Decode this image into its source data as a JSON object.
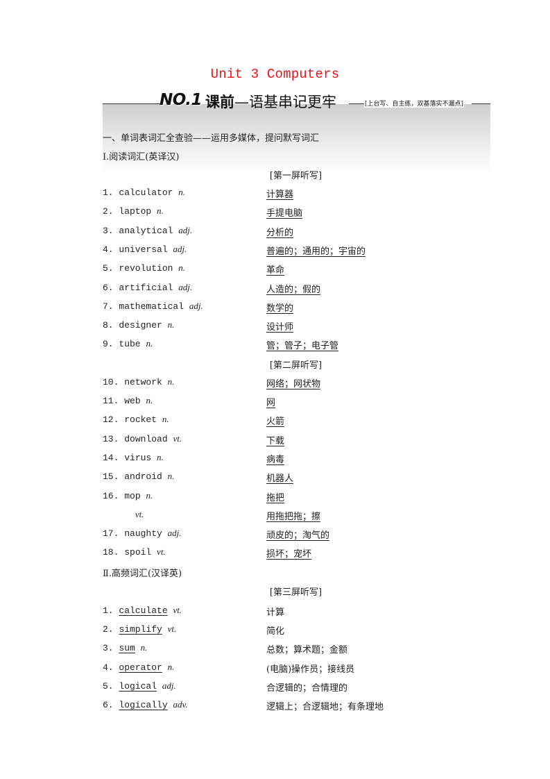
{
  "title": "Unit 3  Computers",
  "banner": {
    "number": "NO.1",
    "heading_bold": "课前",
    "heading_rest": "—语基串记更牢",
    "note": "[上台写、自主练，双基落实不漏点]"
  },
  "section_heading": "一、单词表词汇全查验——运用多媒体，提问默写词汇",
  "part1": {
    "heading": "Ⅰ.阅读词汇(英译汉)",
    "screens": [
      {
        "label": "[第一屏听写]",
        "items": [
          {
            "n": "1.",
            "word": "calculator",
            "pos": "n.",
            "meaning": "计算器"
          },
          {
            "n": "2.",
            "word": "laptop",
            "pos": "n.",
            "meaning": "手提电脑"
          },
          {
            "n": "3.",
            "word": "analytical",
            "pos": "adj.",
            "meaning": "分析的"
          },
          {
            "n": "4.",
            "word": "universal",
            "pos": "adj.",
            "meaning": "普遍的；通用的；宇宙的"
          },
          {
            "n": "5.",
            "word": "revolution",
            "pos": "n.",
            "meaning": "革命"
          },
          {
            "n": "6.",
            "word": "artificial",
            "pos": "adj.",
            "meaning": "人造的；假的"
          },
          {
            "n": "7.",
            "word": "mathematical",
            "pos": "adj.",
            "meaning": "数学的"
          },
          {
            "n": "8.",
            "word": "designer",
            "pos": "n.",
            "meaning": "设计师"
          },
          {
            "n": "9.",
            "word": "tube",
            "pos": "n.",
            "meaning": "管；管子；电子管"
          }
        ]
      },
      {
        "label": "[第二屏听写]",
        "items": [
          {
            "n": "10.",
            "word": "network",
            "pos": "n.",
            "meaning": "网络；网状物"
          },
          {
            "n": "11.",
            "word": "web",
            "pos": "n.",
            "meaning": "网"
          },
          {
            "n": "12.",
            "word": "rocket",
            "pos": "n.",
            "meaning": "火箭"
          },
          {
            "n": "13.",
            "word": "download",
            "pos": "vt.",
            "meaning": "下载"
          },
          {
            "n": "14.",
            "word": "virus",
            "pos": "n.",
            "meaning": "病毒"
          },
          {
            "n": "15.",
            "word": "android",
            "pos": "n.",
            "meaning": "机器人"
          },
          {
            "n": "16.",
            "word": "mop",
            "pos": "n.",
            "meaning": "拖把"
          },
          {
            "n": "",
            "word": "",
            "pos": "vt.",
            "meaning": "用拖把拖；擦"
          },
          {
            "n": "17.",
            "word": "naughty",
            "pos": "adj.",
            "meaning": "顽皮的；淘气的"
          },
          {
            "n": "18.",
            "word": "spoil",
            "pos": "vt.",
            "meaning": "损坏；宠坏"
          }
        ]
      }
    ]
  },
  "part2": {
    "heading": "Ⅱ.高频词汇(汉译英)",
    "screens": [
      {
        "label": "[第三屏听写]",
        "items": [
          {
            "n": "1.",
            "word": "calculate",
            "pos": "vt.",
            "meaning": "计算"
          },
          {
            "n": "2.",
            "word": "simplify",
            "pos": "vt.",
            "meaning": "简化"
          },
          {
            "n": "3.",
            "word": "sum",
            "pos": "n.",
            "meaning": "总数；算术题；金额"
          },
          {
            "n": "4.",
            "word": "operator",
            "pos": "n.",
            "meaning": "(电脑)操作员；接线员"
          },
          {
            "n": "5.",
            "word": "logical",
            "pos": "adj.",
            "meaning": "合逻辑的；合情理的"
          },
          {
            "n": "6.",
            "word": "logically",
            "pos": "adv.",
            "meaning": "逻辑上；合逻辑地；有条理地"
          }
        ]
      }
    ]
  }
}
